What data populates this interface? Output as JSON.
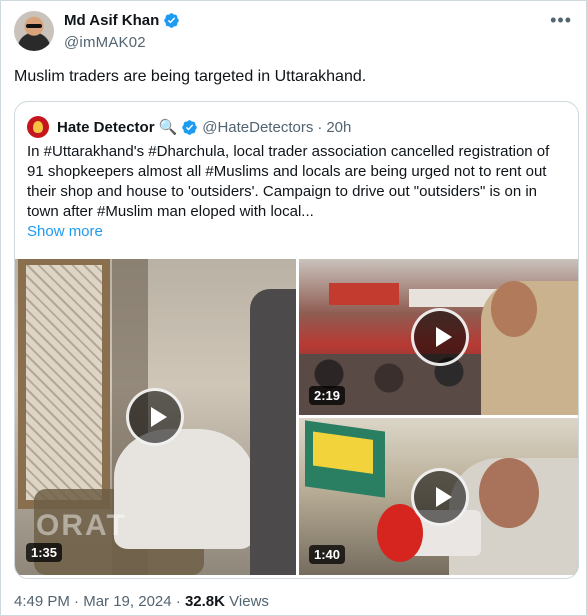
{
  "author": {
    "display_name": "Md Asif Khan",
    "handle": "@imMAK02"
  },
  "tweet": {
    "text": "Muslim traders are being targeted in Uttarakhand."
  },
  "quote": {
    "display_name": "Hate Detector",
    "name_emoji": "🔍",
    "handle": "@HateDetectors",
    "separator": "·",
    "age": "20h",
    "body": "In #Uttarakhand's #Dharchula, local trader association cancelled registration of 91 shopkeepers almost all #Muslims and locals are being urged not to rent out their shop and house to 'outsiders'. Campaign to drive out \"outsiders\" is on in town after #Muslim man eloped with local...",
    "show_more": "Show more",
    "media": [
      {
        "duration": "1:35",
        "watermark": "ORAT"
      },
      {
        "duration": "2:19"
      },
      {
        "duration": "1:40"
      }
    ]
  },
  "footer": {
    "time": "4:49 PM",
    "dot1": "·",
    "date": "Mar 19, 2024",
    "dot2": "·",
    "views_count": "32.8K",
    "views_label": "Views"
  },
  "colors": {
    "accent": "#1d9bf0",
    "secondary_text": "#536471",
    "border": "#cfd9de"
  },
  "icons": [
    "verified-badge-icon",
    "more-options-icon",
    "magnifier-emoji-icon",
    "play-icon"
  ]
}
